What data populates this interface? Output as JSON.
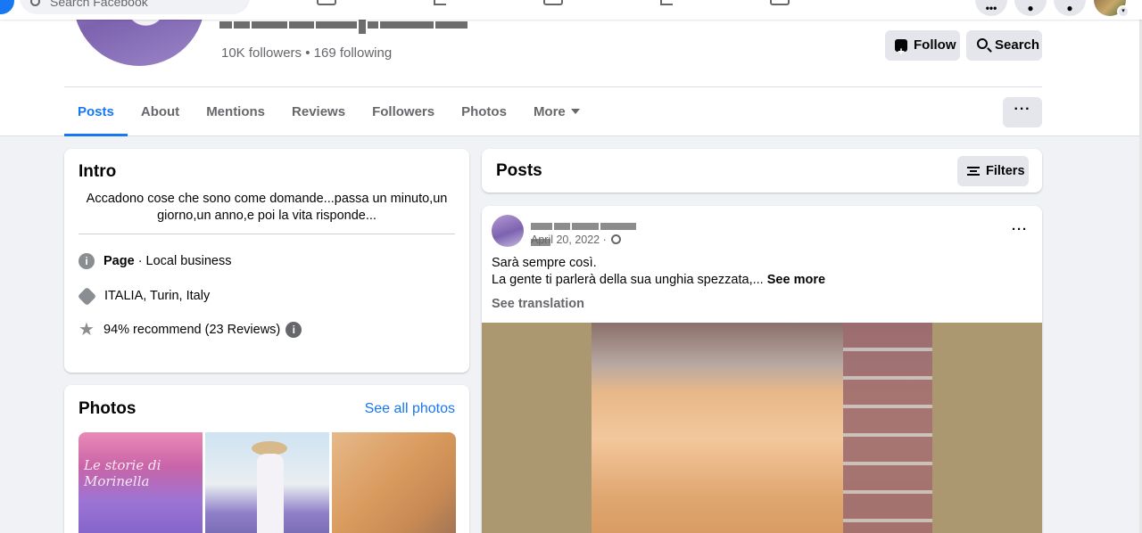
{
  "topbar": {
    "search_placeholder": "Search Facebook"
  },
  "profile": {
    "followers_text": "10K followers • 169 following",
    "follow_label": "Follow",
    "search_label": "Search"
  },
  "tabs": [
    {
      "label": "Posts",
      "active": true
    },
    {
      "label": "About"
    },
    {
      "label": "Mentions"
    },
    {
      "label": "Reviews"
    },
    {
      "label": "Followers"
    },
    {
      "label": "Photos"
    },
    {
      "label": "More"
    }
  ],
  "intro": {
    "title": "Intro",
    "bio": "Accadono cose che sono come domande...passa un minuto,un giorno,un anno,e poi la vita risponde...",
    "category_prefix": "Page",
    "category": " · Local business",
    "location": "ITALIA, Turin, Italy",
    "recommend": "94% recommend (23 Reviews)"
  },
  "photos": {
    "title": "Photos",
    "see_all": "See all photos",
    "watermark": "Le storie di Morinella"
  },
  "posts_section": {
    "title": "Posts",
    "filters_label": "Filters"
  },
  "post": {
    "date": "April 20, 2022 · ",
    "line1": "Sarà sempre così.",
    "line2": "La gente ti parlerà della sua unghia spezzata,... ",
    "see_more": "See more",
    "see_translation": "See translation"
  }
}
